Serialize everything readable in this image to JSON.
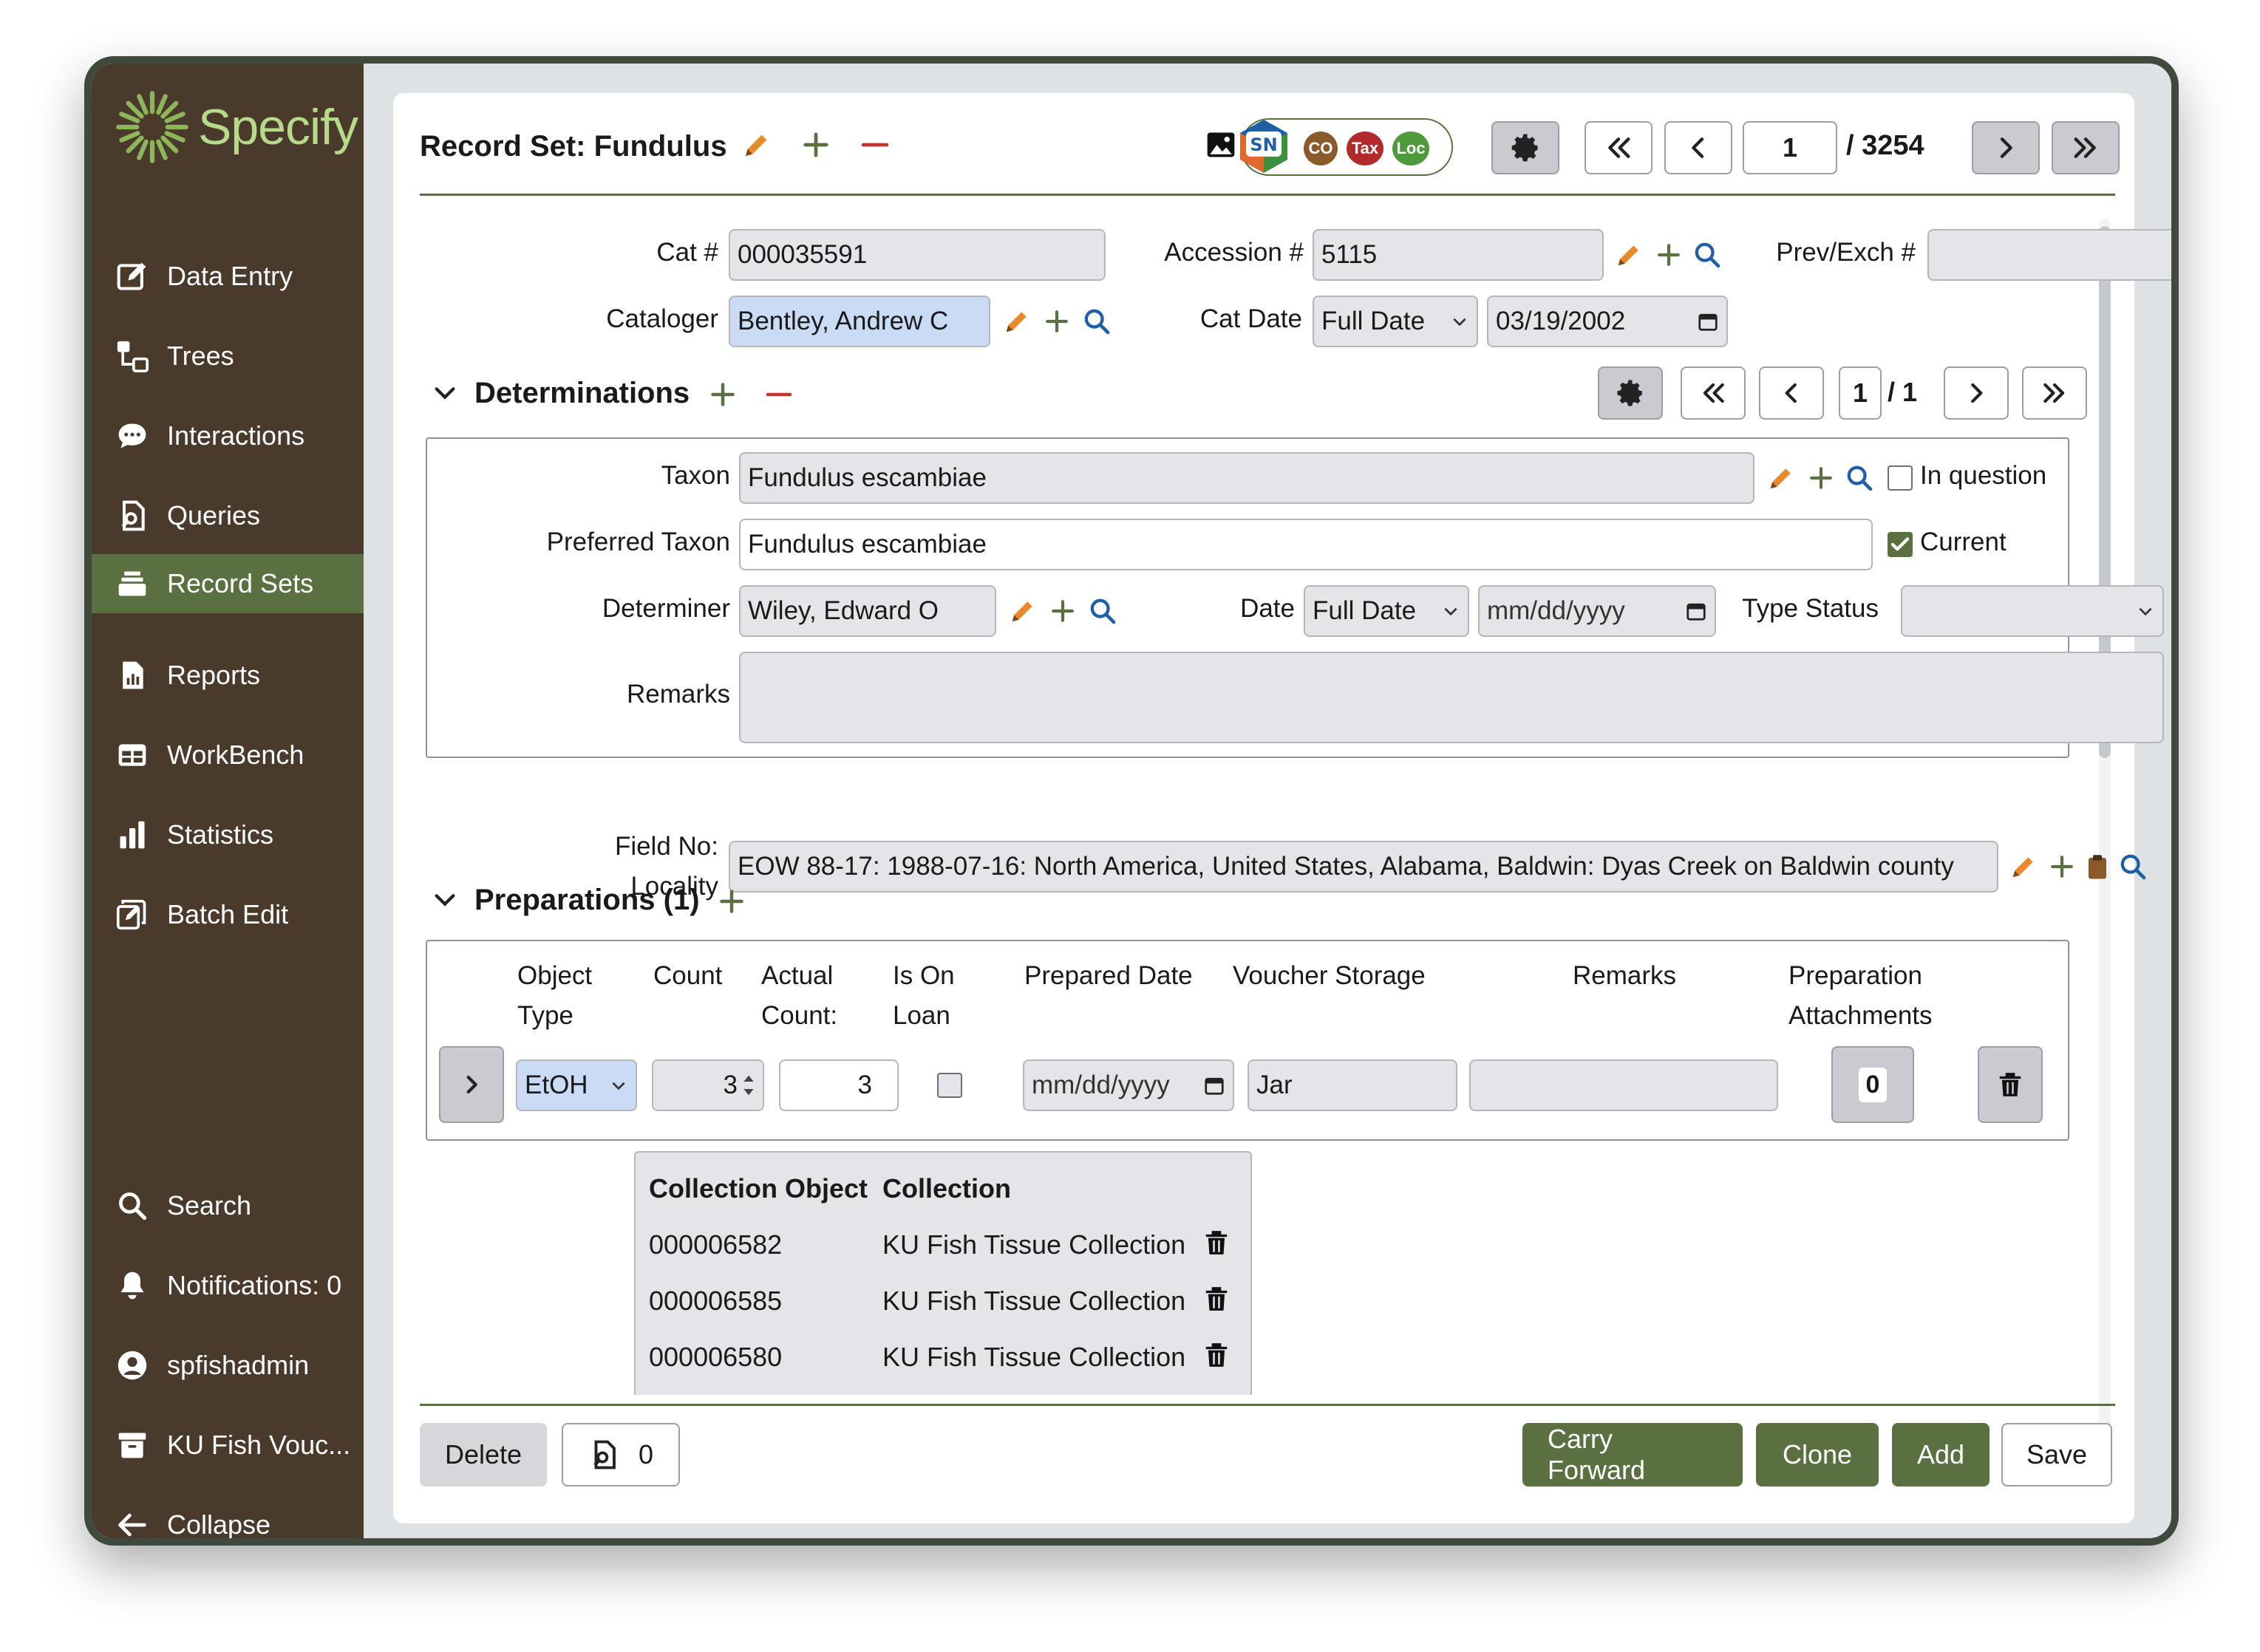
{
  "sidebar": {
    "logo": "Specify",
    "items": [
      {
        "label": "Data Entry"
      },
      {
        "label": "Trees"
      },
      {
        "label": "Interactions"
      },
      {
        "label": "Queries"
      },
      {
        "label": "Record Sets"
      },
      {
        "label": "Reports"
      },
      {
        "label": "WorkBench"
      },
      {
        "label": "Statistics"
      },
      {
        "label": "Batch Edit"
      }
    ],
    "bottom": [
      {
        "label": "Search"
      },
      {
        "label": "Notifications: 0"
      },
      {
        "label": "spfishadmin"
      },
      {
        "label": "KU Fish Vouc..."
      },
      {
        "label": "Collapse"
      }
    ],
    "active_item": "Record Sets"
  },
  "header": {
    "title": "Record Set: Fundulus",
    "badges": [
      "SN",
      "CO",
      "Tax",
      "Loc"
    ],
    "current_record": "1",
    "total_records": "/ 3254"
  },
  "form": {
    "cat_label": "Cat #",
    "cat_value": "000035591",
    "accession_label": "Accession #",
    "accession_value": "5115",
    "prevexch_label": "Prev/Exch #",
    "prevexch_value": "",
    "cataloger_label": "Cataloger",
    "cataloger_value": "Bentley, Andrew C",
    "catdate_label": "Cat Date",
    "catdate_precision": "Full Date",
    "catdate_value": "03/19/2002"
  },
  "determinations": {
    "heading": "Determinations",
    "current": "1",
    "total": "/ 1",
    "taxon_label": "Taxon",
    "taxon_value": "Fundulus escambiae",
    "in_question_label": "In question",
    "in_question_checked": false,
    "preferred_label": "Preferred Taxon",
    "preferred_value": "Fundulus escambiae",
    "current_label": "Current",
    "current_checked": true,
    "determiner_label": "Determiner",
    "determiner_value": "Wiley, Edward O",
    "date_label": "Date",
    "date_precision": "Full Date",
    "date_placeholder": "mm/dd/yyyy",
    "type_status_label": "Type Status",
    "type_status_value": "",
    "remarks_label": "Remarks",
    "remarks_value": ""
  },
  "field_no": {
    "label_line1": "Field No:",
    "label_line2": "Locality",
    "value": "EOW 88-17: 1988-07-16: North America, United States, Alabama, Baldwin: Dyas Creek on Baldwin county"
  },
  "preparations": {
    "heading": "Preparations (1)",
    "columns": {
      "object_type": [
        "Object",
        "Type"
      ],
      "count": "Count",
      "actual_count": [
        "Actual",
        "Count:"
      ],
      "is_on_loan": [
        "Is On",
        "Loan"
      ],
      "prepared_date": "Prepared Date",
      "voucher_storage": "Voucher Storage",
      "remarks": "Remarks",
      "attachments": [
        "Preparation",
        "Attachments"
      ]
    },
    "row": {
      "object_type": "EtOH",
      "count": "3",
      "actual_count": "3",
      "prepared_date_placeholder": "mm/dd/yyyy",
      "voucher_storage": "Jar",
      "remarks": "",
      "attachments_count": "0"
    }
  },
  "collection_table": {
    "headers": [
      "Collection Object",
      "Collection"
    ],
    "rows": [
      {
        "object": "000006582",
        "collection": "KU Fish Tissue Collection"
      },
      {
        "object": "000006585",
        "collection": "KU Fish Tissue Collection"
      },
      {
        "object": "000006580",
        "collection": "KU Fish Tissue Collection"
      }
    ]
  },
  "footer": {
    "delete_label": "Delete",
    "query_count": "0",
    "carry_forward_label": "Carry Forward",
    "clone_label": "Clone",
    "add_label": "Add",
    "save_label": "Save"
  },
  "colors": {
    "sidebar_bg": "#4a3a2c",
    "accent_green": "#5b7040",
    "edit_orange": "#e8892b",
    "search_blue": "#1e5fa8",
    "delete_red": "#c2352a"
  }
}
